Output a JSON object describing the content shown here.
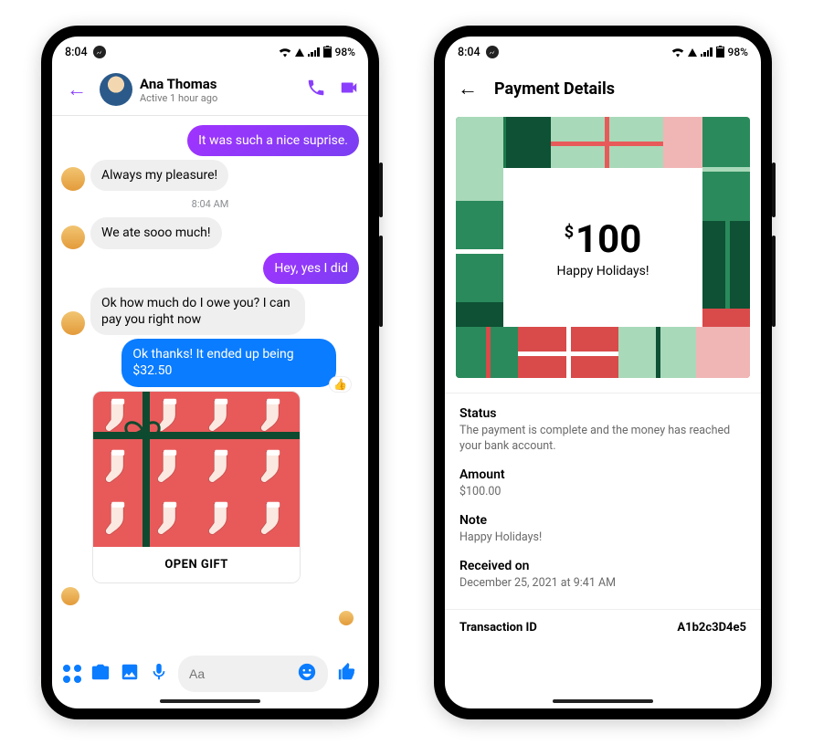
{
  "status_bar": {
    "time": "8:04",
    "battery": "98%"
  },
  "chat": {
    "contact_name": "Ana Thomas",
    "active_status": "Active 1 hour ago",
    "timestamp": "8:04 AM",
    "messages": {
      "m1": "It was such a nice suprise.",
      "m2": "Always my pleasure!",
      "m3": "We ate sooo much!",
      "m4": "Hey, yes I did",
      "m5": "Ok how much do I owe you? I can pay you right now",
      "m6": "Ok thanks! It ended up being $32.50"
    },
    "gift_button": "OPEN GIFT",
    "reaction": "👍",
    "composer_placeholder": "Aa"
  },
  "payment": {
    "title": "Payment Details",
    "amount_symbol": "$",
    "amount_value": "100",
    "amount_message": "Happy Holidays!",
    "sections": {
      "status_label": "Status",
      "status_text": "The payment is complete and the money has reached your bank account.",
      "amount_label": "Amount",
      "amount_text": "$100.00",
      "note_label": "Note",
      "note_text": "Happy Holidays!",
      "received_label": "Received on",
      "received_text": "December 25, 2021 at 9:41 AM"
    },
    "txn_label": "Transaction ID",
    "txn_value": "A1b2c3D4e5"
  }
}
